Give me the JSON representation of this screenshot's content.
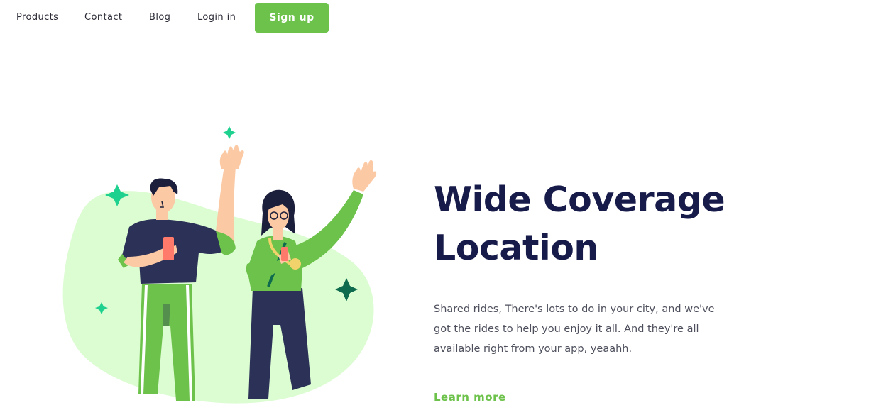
{
  "colors": {
    "accent": "#6cc24a",
    "headline": "#171b4a",
    "blob": "#dcfcd2",
    "navy": "#2b3157",
    "sparkle_teal": "#1fd18f",
    "sparkle_dark": "#0f6b4d"
  },
  "nav": {
    "links": [
      "Products",
      "Contact",
      "Blog",
      "Login in"
    ],
    "signup_label": "Sign up"
  },
  "hero": {
    "title_line1": "Wide Coverage",
    "title_line2": "Location",
    "description": "Shared rides, There's lots to do in your city, and we've got the rides to help you enjoy it all. And they're all available right from your app, yeaahh.",
    "learn_more": "Learn more",
    "illustration": "two-people-waving-with-phones"
  }
}
